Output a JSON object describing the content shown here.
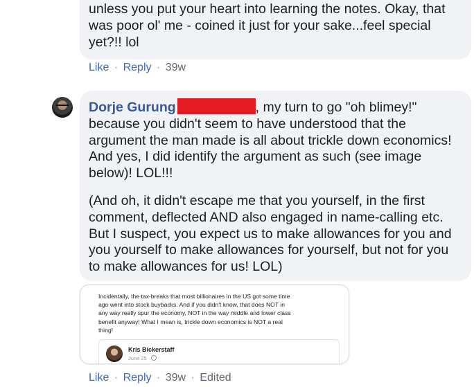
{
  "comment1": {
    "text_lines": [
      "unless you put your heart into learning the notes. Okay, that",
      "was poor ol' me - coined it just for your sake...feel special",
      "yet?!! lol"
    ],
    "actions": {
      "like": "Like",
      "reply": "Reply",
      "time": "39w",
      "sep": "·"
    }
  },
  "comment2": {
    "author": "Dorje Gurung",
    "avatar_icon": "profile-photo",
    "para1_lines": [
      ", my turn to go \"oh blimey!\"",
      "because you didn't seem to have understood that the",
      "argument the man made is all about trickle down economics!",
      "And yes, I did identify the argument as such (see image",
      "below)! LOL!!!"
    ],
    "para2_lines": [
      "(And oh, it didn't escape me that you yourself, in the first",
      "comment, deflected AND also engaged in name-calling etc.",
      "But I suspect, you expect us to make allowances for you and",
      "you yourself to make allowances for yourself, but not for you",
      "to make allowances for us! LOL)"
    ],
    "redaction_color": "#e31b23",
    "attachment": {
      "text_lines": [
        "Incidentally, the tax-breaks that most billionaires in the US got some time",
        "ago went into stock buybacks. And if you didn't know, that does NOT in",
        "any way really spur the economy, NOT in the way middle and lower class",
        "benefit anyway! What I mean is, trickle down economics is NOT a real",
        "thing!"
      ],
      "quoted_author": "Kris Bickerstaff",
      "quoted_date": "June 25 ·"
    },
    "actions": {
      "like": "Like",
      "reply": "Reply",
      "time": "39w",
      "edited": "Edited",
      "sep": "·"
    }
  },
  "colors": {
    "bubble_bg": "#f0f2f5",
    "link": "#4267b2",
    "author": "#385898",
    "meta": "#606770"
  }
}
